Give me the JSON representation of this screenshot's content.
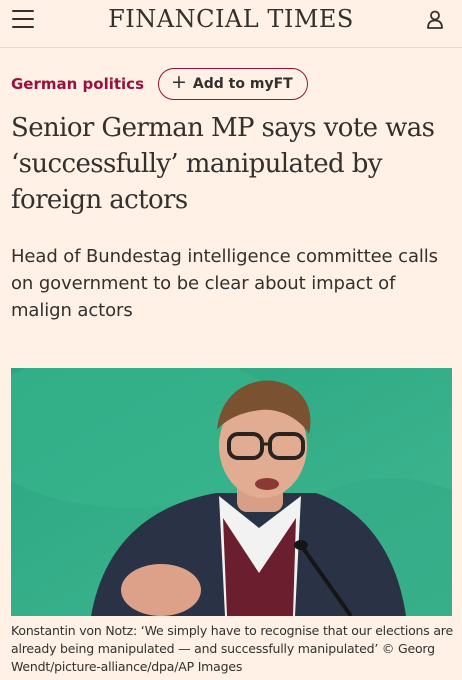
{
  "header": {
    "masthead": "FINANCIAL TIMES",
    "menu_icon": "hamburger-menu-icon",
    "user_icon": "user-account-icon"
  },
  "article": {
    "section": "German politics",
    "follow_label": "Add to myFT",
    "follow_icon": "plus-icon",
    "headline": "Senior German MP says vote was ‘successfully’ manipulated by foreign actors",
    "standfirst": "Head of Bundestag intelligence committee calls on government to be clear about impact of malign actors",
    "image_description_icon": "photo",
    "caption": "Konstantin von Notz: ‘We simply have to recognise that our elections are already being manipulated — and successfully manipulated’ © Georg Wendt/picture-alliance/dpa/AP Images"
  },
  "colors": {
    "background": "#fff1e5",
    "accent": "#990f3d",
    "text": "#33302e",
    "photo_green": "#2fae86"
  }
}
